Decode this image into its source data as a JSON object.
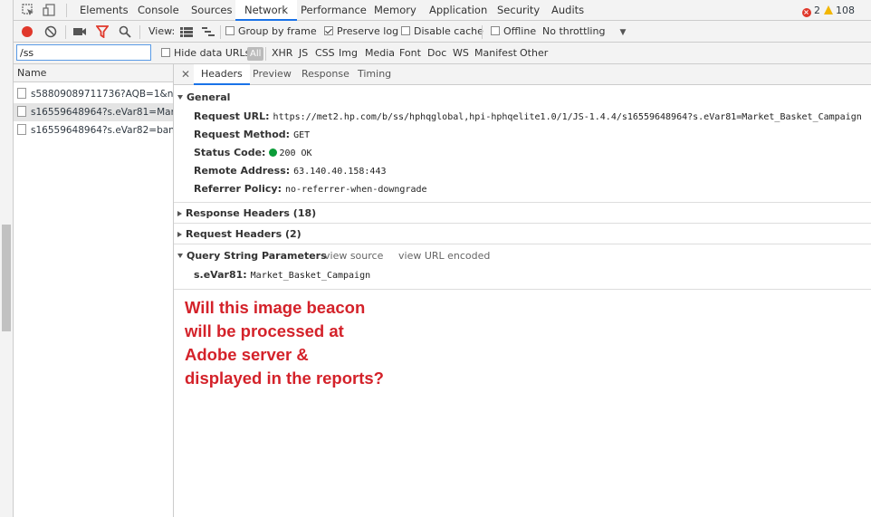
{
  "tabs": [
    "Elements",
    "Console",
    "Sources",
    "Network",
    "Performance",
    "Memory",
    "Application",
    "Security",
    "Audits"
  ],
  "active_tab": "Network",
  "issues": {
    "errors": "2",
    "warnings": "108"
  },
  "toolbar": {
    "view_label": "View:",
    "group_by_frame": "Group by frame",
    "preserve_log": "Preserve log",
    "disable_cache": "Disable cache",
    "offline": "Offline",
    "throttling": "No throttling"
  },
  "filter": {
    "value": "/ss",
    "hide_data_urls": "Hide data URLs",
    "types": [
      "All",
      "XHR",
      "JS",
      "CSS",
      "Img",
      "Media",
      "Font",
      "Doc",
      "WS",
      "Manifest",
      "Other"
    ]
  },
  "request_list": {
    "header": "Name",
    "rows": [
      "s58809089711736?AQB=1&n...",
      "s16559648964?s.eVar81=Mar...",
      "s16559648964?s.eVar82=ban..."
    ]
  },
  "detail_tabs": [
    "Headers",
    "Preview",
    "Response",
    "Timing"
  ],
  "general": {
    "title": "General",
    "request_url_label": "Request URL:",
    "request_url": "https://met2.hp.com/b/ss/hphqglobal,hpi-hphqelite1.0/1/JS-1.4.4/s16559648964?s.eVar81=Market_Basket_Campaign",
    "request_method_label": "Request Method:",
    "request_method": "GET",
    "status_code_label": "Status Code:",
    "status_code": "200 OK",
    "remote_address_label": "Remote Address:",
    "remote_address": "63.140.40.158:443",
    "referrer_policy_label": "Referrer Policy:",
    "referrer_policy": "no-referrer-when-downgrade"
  },
  "response_headers": "Response Headers (18)",
  "request_headers": "Request Headers (2)",
  "query_string": {
    "title": "Query String Parameters",
    "view_source": "view source",
    "view_url_encoded": "view URL encoded",
    "param_key": "s.eVar81:",
    "param_value": "Market_Basket_Campaign"
  },
  "annotation": [
    "Will this image beacon",
    "will be processed at",
    "Adobe server &",
    "displayed in the reports?"
  ]
}
